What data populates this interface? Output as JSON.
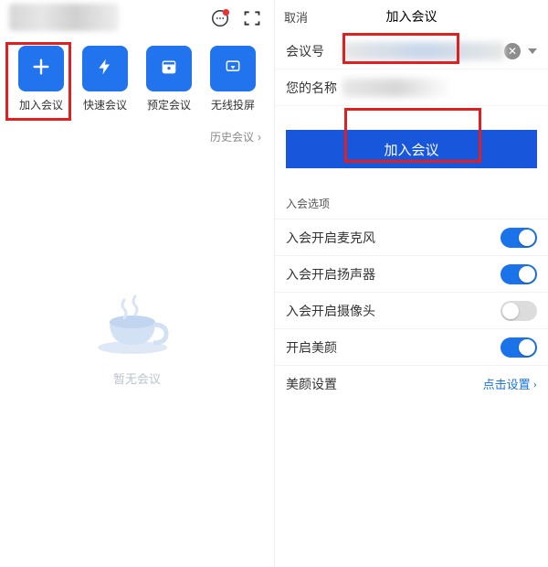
{
  "left": {
    "tiles": [
      {
        "label": "加入会议",
        "icon": "plus"
      },
      {
        "label": "快速会议",
        "icon": "bolt"
      },
      {
        "label": "预定会议",
        "icon": "calendar"
      },
      {
        "label": "无线投屏",
        "icon": "cast"
      }
    ],
    "history_link": "历史会议",
    "empty_text": "暂无会议"
  },
  "right": {
    "cancel": "取消",
    "title": "加入会议",
    "meeting_id_label": "会议号",
    "name_label": "您的名称",
    "join_button": "加入会议",
    "options_section": "入会选项",
    "options": [
      {
        "label": "入会开启麦克风",
        "value": true
      },
      {
        "label": "入会开启扬声器",
        "value": true
      },
      {
        "label": "入会开启摄像头",
        "value": false
      },
      {
        "label": "开启美颜",
        "value": true
      }
    ],
    "beauty_settings_label": "美颜设置",
    "beauty_settings_action": "点击设置"
  }
}
